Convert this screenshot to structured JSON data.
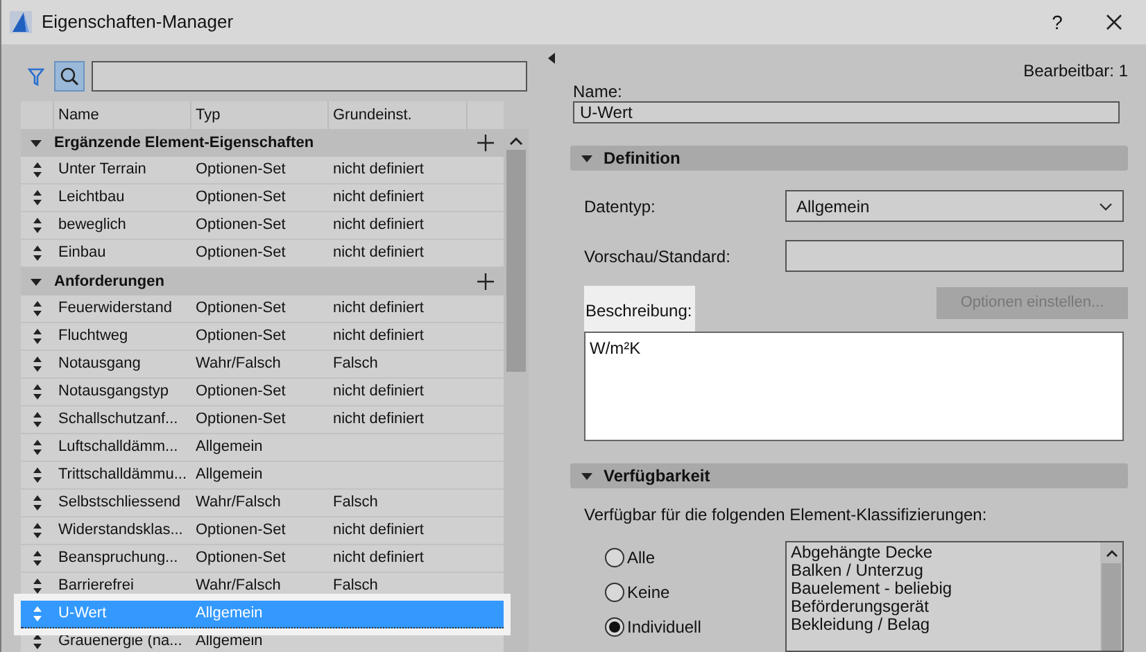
{
  "window": {
    "title": "Eigenschaften-Manager",
    "help": "?"
  },
  "table": {
    "columns": [
      "Name",
      "Typ",
      "Grundeinst."
    ],
    "rows": [
      {
        "kind": "group",
        "name": "Ergänzende Element-Eigenschaften",
        "expanded": true
      },
      {
        "kind": "item",
        "name": "Unter Terrain",
        "type": "Optionen-Set",
        "default": "nicht definiert",
        "selected": false
      },
      {
        "kind": "item",
        "name": "Leichtbau",
        "type": "Optionen-Set",
        "default": "nicht definiert",
        "selected": false
      },
      {
        "kind": "item",
        "name": "beweglich",
        "type": "Optionen-Set",
        "default": "nicht definiert",
        "selected": false
      },
      {
        "kind": "item",
        "name": "Einbau",
        "type": "Optionen-Set",
        "default": "nicht definiert",
        "selected": false
      },
      {
        "kind": "group",
        "name": "Anforderungen",
        "expanded": true
      },
      {
        "kind": "item",
        "name": "Feuerwiderstand",
        "type": "Optionen-Set",
        "default": "nicht definiert",
        "selected": false
      },
      {
        "kind": "item",
        "name": "Fluchtweg",
        "type": "Optionen-Set",
        "default": "nicht definiert",
        "selected": false
      },
      {
        "kind": "item",
        "name": "Notausgang",
        "type": "Wahr/Falsch",
        "default": "Falsch",
        "selected": false
      },
      {
        "kind": "item",
        "name": "Notausgangstyp",
        "type": "Optionen-Set",
        "default": "nicht definiert",
        "selected": false
      },
      {
        "kind": "item",
        "name": "Schallschutzanf...",
        "type": "Optionen-Set",
        "default": "nicht definiert",
        "selected": false
      },
      {
        "kind": "item",
        "name": "Luftschalldämm...",
        "type": "Allgemein",
        "selected": false
      },
      {
        "kind": "item",
        "name": "Trittschalldämmu...",
        "type": "Allgemein",
        "selected": false
      },
      {
        "kind": "item",
        "name": "Selbstschliessend",
        "type": "Wahr/Falsch",
        "default": "Falsch",
        "selected": false
      },
      {
        "kind": "item",
        "name": "Widerstandsklas...",
        "type": "Optionen-Set",
        "default": "nicht definiert",
        "selected": false
      },
      {
        "kind": "item",
        "name": "Beanspruchung...",
        "type": "Optionen-Set",
        "default": "nicht definiert",
        "selected": false
      },
      {
        "kind": "item",
        "name": "Barrierefrei",
        "type": "Wahr/Falsch",
        "default": "Falsch",
        "selected": false
      },
      {
        "kind": "item",
        "name": "U-Wert",
        "type": "Allgemein",
        "selected": true
      },
      {
        "kind": "item",
        "name": "Grauenergie (na...",
        "type": "Allgemein",
        "selected": false
      }
    ]
  },
  "details": {
    "editable": "Bearbeitbar: 1",
    "name_label": "Name:",
    "name_value": "U-Wert",
    "definition": {
      "title": "Definition",
      "expanded": true,
      "datatype_label": "Datentyp:",
      "datatype_value": "Allgemein",
      "preview_label": "Vorschau/Standard:",
      "description_label": "Beschreibung:",
      "options_button": {
        "label": "Optionen einstellen...",
        "disabled": true
      },
      "description_value": "W/m²K"
    },
    "availability": {
      "title": "Verfügbarkeit",
      "expanded": true,
      "caption": "Verfügbar für die folgenden Element-Klassifizierungen:",
      "options": [
        {
          "label": "Alle",
          "selected": false
        },
        {
          "label": "Keine",
          "selected": false
        },
        {
          "label": "Individuell",
          "selected": true
        }
      ],
      "classifications": [
        "Abgehängte Decke",
        "Balken / Unterzug",
        "Bauelement - beliebig",
        "Beförderungsgerät",
        "Bekleidung / Belag"
      ]
    }
  }
}
